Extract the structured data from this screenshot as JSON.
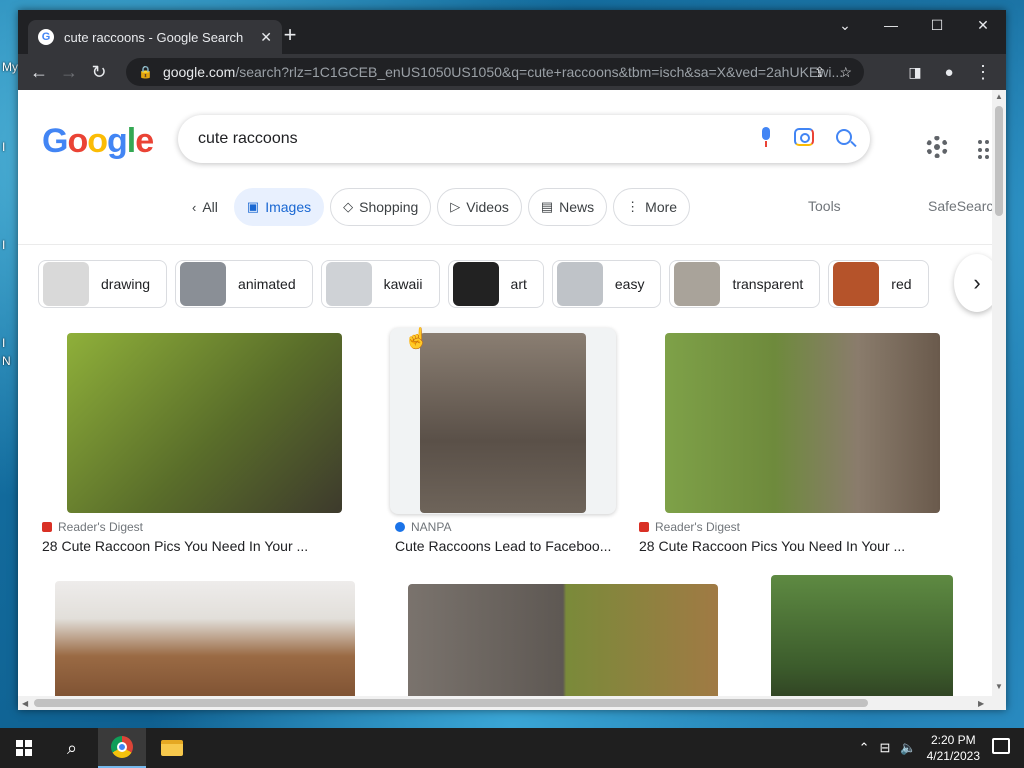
{
  "desktop": {
    "labels": [
      "My",
      "I",
      "I",
      "I",
      "N"
    ]
  },
  "browser": {
    "tab_title": "cute raccoons - Google Search",
    "url_host": "google.com",
    "url_rest": "/search?rlz=1C1GCEB_enUS1050US1050&q=cute+raccoons&tbm=isch&sa=X&ved=2ahUKEwi..."
  },
  "google": {
    "logo": [
      "G",
      "o",
      "o",
      "g",
      "l",
      "e"
    ],
    "search_value": "cute raccoons",
    "nav": [
      {
        "label": "All",
        "icon": "chevron-left-icon"
      },
      {
        "label": "Images",
        "icon": "image-icon",
        "active": true
      },
      {
        "label": "Shopping",
        "icon": "tag-icon"
      },
      {
        "label": "Videos",
        "icon": "play-icon"
      },
      {
        "label": "News",
        "icon": "news-icon"
      },
      {
        "label": "More",
        "icon": "kebab-icon"
      }
    ],
    "tools": "Tools",
    "safesearch": "SafeSearch",
    "chips": [
      {
        "label": "drawing",
        "color": "#d9d9d9"
      },
      {
        "label": "animated",
        "color": "#8a8f96"
      },
      {
        "label": "kawaii",
        "color": "#cfd2d6"
      },
      {
        "label": "art",
        "color": "#222222"
      },
      {
        "label": "easy",
        "color": "#bfc3c8"
      },
      {
        "label": "transparent",
        "color": "#a9a39a"
      },
      {
        "label": "red",
        "color": "#b5532a"
      }
    ],
    "results": [
      {
        "source": "Reader's Digest",
        "caption": "28 Cute Raccoon Pics You Need In Your ...",
        "colors": [
          "#7a9a2a",
          "#3f4a22"
        ]
      },
      {
        "source": "NANPA",
        "caption": "Cute Raccoons Lead to Faceboo...",
        "colors": [
          "#7d7268",
          "#4a423b"
        ]
      },
      {
        "source": "Reader's Digest",
        "caption": "28 Cute Raccoon Pics You Need In Your ...",
        "colors": [
          "#6a8f3a",
          "#8c7d6e"
        ]
      }
    ],
    "row2_colors": [
      [
        "#e8e6e2",
        "#8a5a3a"
      ],
      [
        "#6a6662",
        "#8a7a4a"
      ],
      [
        "#4f7a3a",
        "#2f4a22"
      ]
    ]
  },
  "taskbar": {
    "time": "2:20 PM",
    "date": "4/21/2023"
  }
}
